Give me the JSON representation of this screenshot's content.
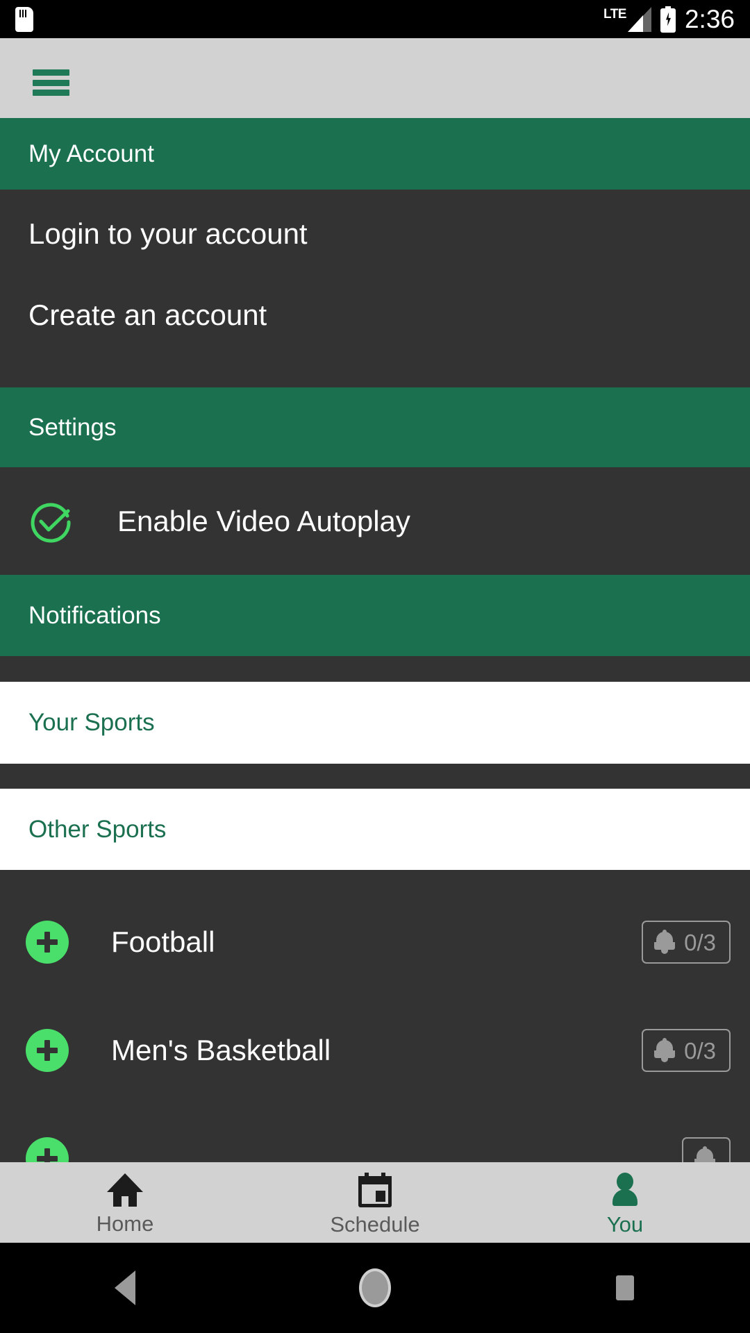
{
  "status_bar": {
    "sd_card_icon": "sd-card-icon",
    "network_label": "LTE",
    "signal_icon": "signal-bars-icon",
    "battery_icon": "battery-charging-icon",
    "time": "2:36"
  },
  "app_bar": {
    "menu_icon": "hamburger-menu-icon"
  },
  "sections": {
    "my_account": {
      "title": "My Account",
      "items": [
        {
          "label": "Login to your account"
        },
        {
          "label": "Create an account"
        }
      ]
    },
    "settings": {
      "title": "Settings",
      "autoplay": {
        "label": "Enable Video Autoplay",
        "checked": true,
        "icon": "check-circle-icon"
      }
    },
    "notifications": {
      "title": "Notifications",
      "your_sports": {
        "title": "Your Sports"
      },
      "other_sports": {
        "title": "Other Sports",
        "rows": [
          {
            "name": "Football",
            "add_icon": "plus-circle-icon",
            "bell_icon": "bell-icon",
            "count": "0/3"
          },
          {
            "name": "Men's Basketball",
            "add_icon": "plus-circle-icon",
            "bell_icon": "bell-icon",
            "count": "0/3"
          }
        ]
      }
    }
  },
  "bottom_nav": {
    "items": [
      {
        "label": "Home",
        "icon": "home-icon",
        "active": false
      },
      {
        "label": "Schedule",
        "icon": "calendar-icon",
        "active": false
      },
      {
        "label": "You",
        "icon": "person-icon",
        "active": true
      }
    ]
  },
  "android_nav": {
    "back_icon": "back-triangle-icon",
    "home_icon": "home-circle-icon",
    "recents_icon": "recents-square-icon"
  },
  "colors": {
    "brand_green": "#1b7050",
    "accent_green": "#4ade6a",
    "dark_panel": "#333333",
    "chrome_grey": "#d2d2d2"
  }
}
